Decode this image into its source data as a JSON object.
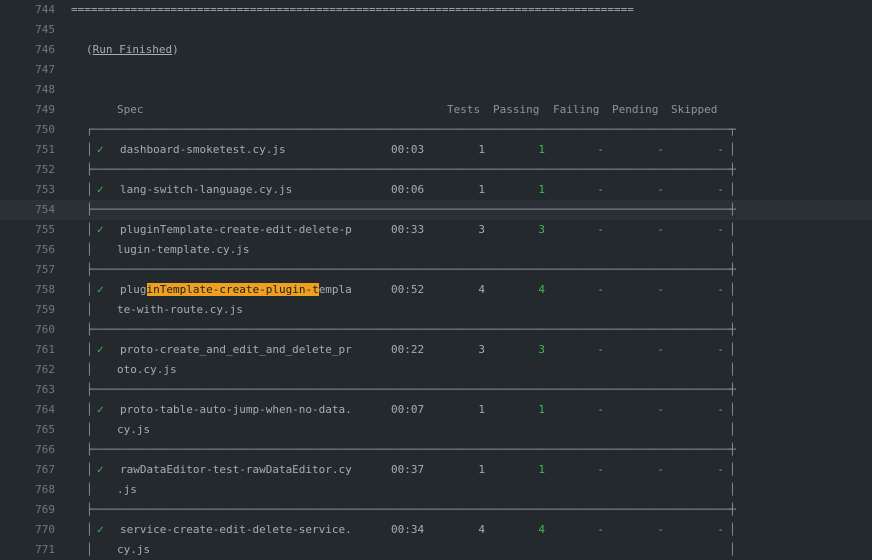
{
  "lines": [
    {
      "n": "744",
      "kind": "rule",
      "text": "====================================================================================="
    },
    {
      "n": "745",
      "kind": "blank"
    },
    {
      "n": "746",
      "kind": "runfinished",
      "pre": "(",
      "link": "Run Finished",
      "post": ")"
    },
    {
      "n": "747",
      "kind": "blank"
    },
    {
      "n": "748",
      "kind": "blank"
    },
    {
      "n": "749",
      "kind": "header"
    },
    {
      "n": "750",
      "kind": "top"
    },
    {
      "n": "751",
      "kind": "row",
      "spec": "dashboard-smoketest.cy.js",
      "time": "00:03",
      "tests": "1",
      "passing": "1",
      "failing": "-",
      "pending": "-",
      "skipped": "-"
    },
    {
      "n": "752",
      "kind": "sep"
    },
    {
      "n": "753",
      "kind": "row",
      "spec": "lang-switch-language.cy.js",
      "time": "00:06",
      "tests": "1",
      "passing": "1",
      "failing": "-",
      "pending": "-",
      "skipped": "-"
    },
    {
      "n": "754",
      "kind": "sep",
      "highlight": true
    },
    {
      "n": "755",
      "kind": "row",
      "spec": "pluginTemplate-create-edit-delete-p",
      "time": "00:33",
      "tests": "3",
      "passing": "3",
      "failing": "-",
      "pending": "-",
      "skipped": "-"
    },
    {
      "n": "756",
      "kind": "cont",
      "spec": "lugin-template.cy.js"
    },
    {
      "n": "757",
      "kind": "sep"
    },
    {
      "n": "758",
      "kind": "rowmatch",
      "spec_pre": "plug",
      "spec_match": "inTemplate-create-plugin-t",
      "spec_post": "empla",
      "time": "00:52",
      "tests": "4",
      "passing": "4",
      "failing": "-",
      "pending": "-",
      "skipped": "-"
    },
    {
      "n": "759",
      "kind": "cont",
      "spec": "te-with-route.cy.js"
    },
    {
      "n": "760",
      "kind": "sep"
    },
    {
      "n": "761",
      "kind": "row",
      "spec": "proto-create_and_edit_and_delete_pr",
      "time": "00:22",
      "tests": "3",
      "passing": "3",
      "failing": "-",
      "pending": "-",
      "skipped": "-"
    },
    {
      "n": "762",
      "kind": "cont",
      "spec": "oto.cy.js"
    },
    {
      "n": "763",
      "kind": "sep"
    },
    {
      "n": "764",
      "kind": "row",
      "spec": "proto-table-auto-jump-when-no-data.",
      "time": "00:07",
      "tests": "1",
      "passing": "1",
      "failing": "-",
      "pending": "-",
      "skipped": "-"
    },
    {
      "n": "765",
      "kind": "cont",
      "spec": "cy.js"
    },
    {
      "n": "766",
      "kind": "sep"
    },
    {
      "n": "767",
      "kind": "row",
      "spec": "rawDataEditor-test-rawDataEditor.cy",
      "time": "00:37",
      "tests": "1",
      "passing": "1",
      "failing": "-",
      "pending": "-",
      "skipped": "-"
    },
    {
      "n": "768",
      "kind": "cont",
      "spec": ".js"
    },
    {
      "n": "769",
      "kind": "sep"
    },
    {
      "n": "770",
      "kind": "row",
      "spec": "service-create-edit-delete-service.",
      "time": "00:34",
      "tests": "4",
      "passing": "4",
      "failing": "-",
      "pending": "-",
      "skipped": "-"
    },
    {
      "n": "771",
      "kind": "cont",
      "spec": "cy.js"
    }
  ],
  "header": {
    "spec": "Spec",
    "tests": "Tests",
    "passing": "Passing",
    "failing": "Failing",
    "pending": "Pending",
    "skipped": "Skipped"
  },
  "glyphs": {
    "check": "✓",
    "vbar": "│",
    "top_left": "┌",
    "top_right": "┐",
    "tee_left": "├",
    "tee_right": "┤",
    "horiz": "─"
  },
  "colors": {
    "background": "#24292e",
    "pass": "#3fb950",
    "match_highlight": "#f0a020"
  }
}
